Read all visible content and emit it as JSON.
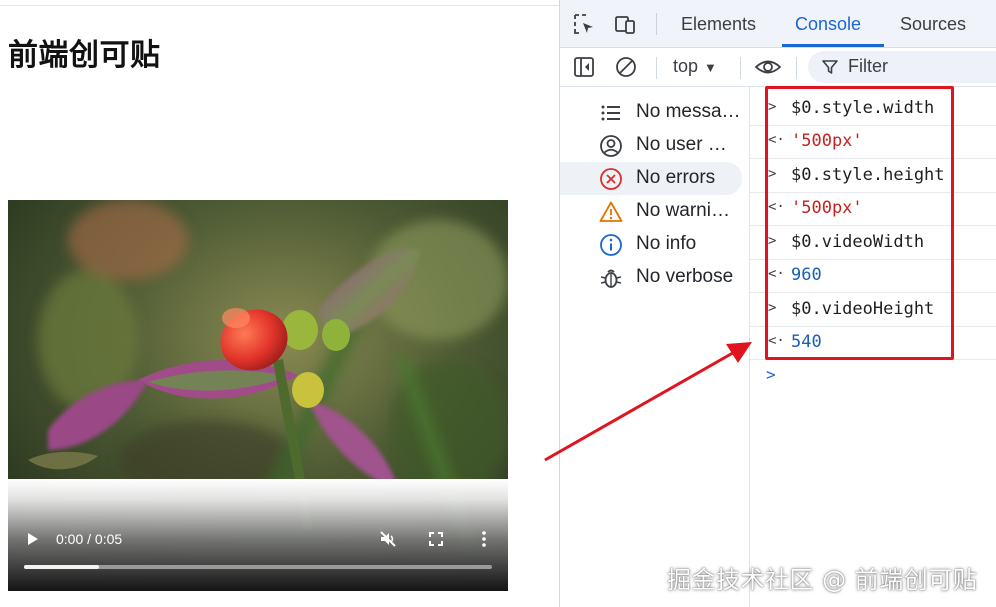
{
  "page": {
    "title": "前端创可贴",
    "video": {
      "time": "0:00 / 0:05",
      "progress_fraction": 0.16,
      "icons": [
        "play-icon",
        "muted-icon",
        "fullscreen-icon",
        "more-vert-icon"
      ]
    }
  },
  "devtools": {
    "tabs": [
      "Elements",
      "Console",
      "Sources"
    ],
    "active_tab": "Console",
    "context": "top",
    "filter_placeholder": "Filter",
    "sidebar": [
      {
        "label": "No messa…",
        "icon": "list-icon"
      },
      {
        "label": "No user …",
        "icon": "user-icon"
      },
      {
        "label": "No errors",
        "icon": "error-icon",
        "selected": true
      },
      {
        "label": "No warni…",
        "icon": "warning-icon"
      },
      {
        "label": "No info",
        "icon": "info-icon"
      },
      {
        "label": "No verbose",
        "icon": "bug-icon"
      }
    ],
    "console_log": [
      {
        "arrow": ">",
        "text": "$0.style.width",
        "kind": "cmd"
      },
      {
        "arrow": "<·",
        "text": "'500px'",
        "kind": "str"
      },
      {
        "arrow": ">",
        "text": "$0.style.height",
        "kind": "cmd"
      },
      {
        "arrow": "<·",
        "text": "'500px'",
        "kind": "str"
      },
      {
        "arrow": ">",
        "text": "$0.videoWidth",
        "kind": "cmd"
      },
      {
        "arrow": "<·",
        "text": "960",
        "kind": "num"
      },
      {
        "arrow": ">",
        "text": "$0.videoHeight",
        "kind": "cmd"
      },
      {
        "arrow": "<·",
        "text": "540",
        "kind": "num"
      }
    ],
    "prompt": ">"
  },
  "colors": {
    "accent": "#1a66d2",
    "annotation": "#e0141e",
    "string": "#c5221f",
    "number": "#1a5fb4"
  },
  "watermark": "掘金技术社区 @ 前端创可贴"
}
